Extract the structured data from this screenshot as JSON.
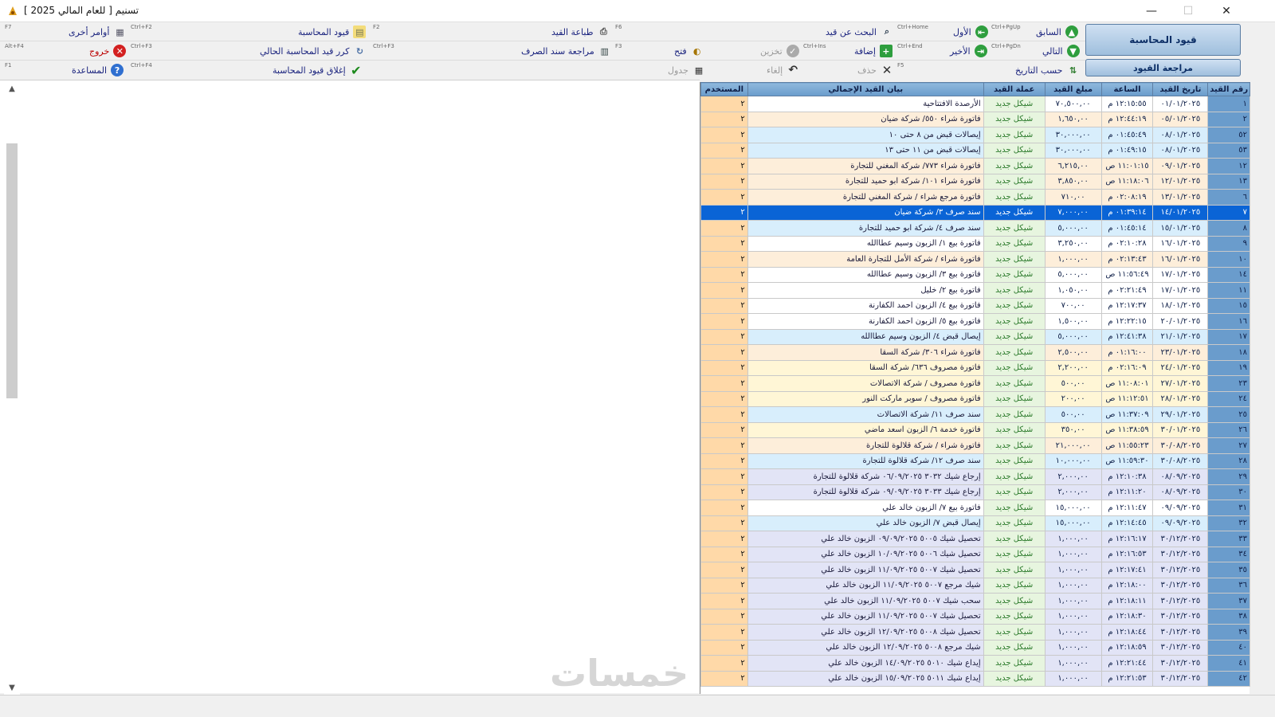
{
  "window": {
    "title": "تسنيم  [ للعام المالي 2025 ]",
    "minimize": "—",
    "maximize": "☐",
    "close": "✕"
  },
  "toolbar": {
    "big_buttons": {
      "journal": "قيود المحاسبة",
      "review": "مراجعة القيود"
    },
    "row1": [
      {
        "label": "السابق",
        "key": "Ctrl+PgUp",
        "icon": "arrow-up-icon",
        "enabled": true
      },
      {
        "label": "الأول",
        "key": "Ctrl+PgUp",
        "icon": "first-icon",
        "enabled": true
      },
      {
        "label": "البحث عن قيد",
        "key": "Ctrl+Home",
        "icon": "search-icon",
        "enabled": true
      },
      {
        "label": "طباعة القيد",
        "key": "F6",
        "icon": "print-icon",
        "enabled": true
      },
      {
        "label": "قيود المحاسبة",
        "key": "F2",
        "icon": "journal-icon",
        "enabled": true
      },
      {
        "label": "أوامر أخرى",
        "key": "Ctrl+F2",
        "icon": "commands-icon",
        "enabled": true
      },
      {
        "label": "",
        "key": "F7",
        "icon": "",
        "enabled": true
      }
    ],
    "row2": [
      {
        "label": "التالي",
        "key": "Ctrl+PgDn",
        "icon": "arrow-down-icon",
        "enabled": true
      },
      {
        "label": "الأخير",
        "key": "Ctrl+PgDn",
        "icon": "last-icon",
        "enabled": true
      },
      {
        "label": "إضافة",
        "key": "Ctrl+End",
        "icon": "add-icon",
        "enabled": true
      },
      {
        "label": "تخزين",
        "key": "Ctrl+Ins",
        "icon": "save-icon",
        "enabled": false
      },
      {
        "label": "فتح",
        "key": "F3",
        "icon": "open-icon",
        "enabled": true
      },
      {
        "label": "مراجعة سند الصرف",
        "key": "F3",
        "icon": "voucher-icon",
        "enabled": true
      },
      {
        "label": "كرر قيد المحاسبة الحالي",
        "key": "Ctrl+F3",
        "icon": "repeat-icon",
        "enabled": true
      },
      {
        "label": "خروج",
        "key": "Alt+F4",
        "icon": "exit-icon",
        "enabled": true
      }
    ],
    "row3": [
      {
        "label": "حسب التاريخ",
        "key": "",
        "icon": "sort-date-icon",
        "enabled": true
      },
      {
        "label": "حذف",
        "key": "F5",
        "icon": "delete-icon",
        "enabled": false
      },
      {
        "label": "إلغاء",
        "key": "",
        "icon": "undo-icon",
        "enabled": false
      },
      {
        "label": "جدول",
        "key": "",
        "icon": "table-icon",
        "enabled": false
      },
      {
        "label": "إغلاق قيود المحاسبة",
        "key": "Ctrl+F4",
        "icon": "check-icon",
        "enabled": true
      },
      {
        "label": "المساعدة",
        "key": "F1",
        "icon": "help-icon",
        "enabled": true
      }
    ]
  },
  "table": {
    "headers": [
      "رقم القيد",
      "تاريخ القيد",
      "الساعة",
      "مبلغ القيد",
      "عملة القيد",
      "بيان القيد الإجمالي",
      "المستخدم"
    ],
    "selected_index": 7,
    "rows": [
      {
        "no": "١",
        "date": "٠١/٠١/٢٠٢٥",
        "time": "١٢:١٥:٥٥ م",
        "amount": "٧٠,٥٠٠,٠٠",
        "currency": "شيكل جديد",
        "statement": "الأرصدة الافتتاحية",
        "user": "٢",
        "tint": "#ffffff"
      },
      {
        "no": "٢",
        "date": "٠٥/٠١/٢٠٢٥",
        "time": "١٢:٤٤:١٩ م",
        "amount": "١,٦٥٠,٠٠",
        "currency": "شيكل جديد",
        "statement": "فاتورة شراء ٥٥٠/ شركة ضيان",
        "user": "٢",
        "tint": "#fdeeda"
      },
      {
        "no": "٥٢",
        "date": "٠٨/٠١/٢٠٢٥",
        "time": "٠١:٤٥:٤٩ م",
        "amount": "٣٠,٠٠٠,٠٠",
        "currency": "شيكل جديد",
        "statement": "إيصالات قبض من ٨ حتى ١٠",
        "user": "٢",
        "tint": "#d8eefc"
      },
      {
        "no": "٥٣",
        "date": "٠٨/٠١/٢٠٢٥",
        "time": "٠١:٤٩:١٥ م",
        "amount": "٣٠,٠٠٠,٠٠",
        "currency": "شيكل جديد",
        "statement": "إيصالات قبض من ١١ حتى ١٣",
        "user": "٢",
        "tint": "#d8eefc"
      },
      {
        "no": "١٢",
        "date": "٠٩/٠١/٢٠٢٥",
        "time": "١١:٠١:١٥ ص",
        "amount": "٦,٢١٥,٠٠",
        "currency": "شيكل جديد",
        "statement": "فاتورة شراء ٧٧٣/ شركة المغني للتجارة",
        "user": "٢",
        "tint": "#fdeeda"
      },
      {
        "no": "١٣",
        "date": "١٢/٠١/٢٠٢٥",
        "time": "١١:١٨:٠٦ ص",
        "amount": "٣,٨٥٠,٠٠",
        "currency": "شيكل جديد",
        "statement": "فاتورة شراء ١٠١/ شركة ابو حميد للتجارة",
        "user": "٢",
        "tint": "#fdeeda"
      },
      {
        "no": "٦",
        "date": "١٣/٠١/٢٠٢٥",
        "time": "٠٢:٠٨:١٩ م",
        "amount": "٧١٠,٠٠",
        "currency": "شيكل جديد",
        "statement": "فاتورة مرجع شراء / شركة المغني للتجارة",
        "user": "٢",
        "tint": "#fdeeda"
      },
      {
        "no": "٧",
        "date": "١٤/٠١/٢٠٢٥",
        "time": "٠١:٣٩:١٤ م",
        "amount": "٧,٠٠٠,٠٠",
        "currency": "شيكل جديد",
        "statement": "سند صرف ٣/ شركة ضيان",
        "user": "٢",
        "tint": "#d8eefc"
      },
      {
        "no": "٨",
        "date": "١٥/٠١/٢٠٢٥",
        "time": "٠١:٤٥:١٤ م",
        "amount": "٥,٠٠٠,٠٠",
        "currency": "شيكل جديد",
        "statement": "سند صرف ٤/ شركة ابو حميد للتجارة",
        "user": "٢",
        "tint": "#d8eefc"
      },
      {
        "no": "٩",
        "date": "١٦/٠١/٢٠٢٥",
        "time": "٠٢:١٠:٢٨ م",
        "amount": "٣,٢٥٠,٠٠",
        "currency": "شيكل جديد",
        "statement": "فاتورة بيع ١/ الزبون وسيم عطاالله",
        "user": "٢",
        "tint": "#ffffff"
      },
      {
        "no": "١٠",
        "date": "١٦/٠١/٢٠٢٥",
        "time": "٠٢:١٣:٤٣ م",
        "amount": "١,٠٠٠,٠٠",
        "currency": "شيكل جديد",
        "statement": "فاتورة شراء / شركة الأمل للتجارة العامة",
        "user": "٢",
        "tint": "#fdeeda"
      },
      {
        "no": "١٤",
        "date": "١٧/٠١/٢٠٢٥",
        "time": "١١:٥٦:٤٩ ص",
        "amount": "٥,٠٠٠,٠٠",
        "currency": "شيكل جديد",
        "statement": "فاتورة بيع ٣/ الزبون وسيم عطاالله",
        "user": "٢",
        "tint": "#ffffff"
      },
      {
        "no": "١١",
        "date": "١٧/٠١/٢٠٢٥",
        "time": "٠٢:٢١:٤٩ م",
        "amount": "١,٠٥٠,٠٠",
        "currency": "شيكل جديد",
        "statement": "فاتورة بيع ٢/ خليل",
        "user": "٢",
        "tint": "#ffffff"
      },
      {
        "no": "١٥",
        "date": "١٨/٠١/٢٠٢٥",
        "time": "١٢:١٧:٣٧ م",
        "amount": "٧٠٠,٠٠",
        "currency": "شيكل جديد",
        "statement": "فاتورة بيع ٤/ الزبون احمد الكفارنة",
        "user": "٢",
        "tint": "#ffffff"
      },
      {
        "no": "١٦",
        "date": "٢٠/٠١/٢٠٢٥",
        "time": "١٢:٢٢:١٥ م",
        "amount": "١,٥٠٠,٠٠",
        "currency": "شيكل جديد",
        "statement": "فاتورة بيع ٥/ الزبون احمد الكفارنة",
        "user": "٢",
        "tint": "#ffffff"
      },
      {
        "no": "١٧",
        "date": "٢١/٠١/٢٠٢٥",
        "time": "١٢:٤١:٣٨ م",
        "amount": "٥,٠٠٠,٠٠",
        "currency": "شيكل جديد",
        "statement": "إيصال قبض ٤/ الزبون وسيم عطاالله",
        "user": "٢",
        "tint": "#d8eefc"
      },
      {
        "no": "١٨",
        "date": "٢٣/٠١/٢٠٢٥",
        "time": "٠١:١٦:٠٠ م",
        "amount": "٢,٥٠٠,٠٠",
        "currency": "شيكل جديد",
        "statement": "فاتورة شراء ٣٠٦/ شركة السقا",
        "user": "٢",
        "tint": "#fdeeda"
      },
      {
        "no": "١٩",
        "date": "٢٤/٠١/٢٠٢٥",
        "time": "٠٢:١٦:٠٩ م",
        "amount": "٢,٢٠٠,٠٠",
        "currency": "شيكل جديد",
        "statement": "فاتورة مصروف ٦٣٦/ شركة السقا",
        "user": "٢",
        "tint": "#fff6d6"
      },
      {
        "no": "٢٣",
        "date": "٢٧/٠١/٢٠٢٥",
        "time": "١١:٠٨:٠١ ص",
        "amount": "٥٠٠,٠٠",
        "currency": "شيكل جديد",
        "statement": "فاتورة مصروف / شركة الاتصالات",
        "user": "٢",
        "tint": "#fff6d6"
      },
      {
        "no": "٢٤",
        "date": "٢٨/٠١/٢٠٢٥",
        "time": "١١:١٢:٥١ ص",
        "amount": "٢٠٠,٠٠",
        "currency": "شيكل جديد",
        "statement": "فاتورة مصروف / سوبر ماركت النور",
        "user": "٢",
        "tint": "#fff6d6"
      },
      {
        "no": "٢٥",
        "date": "٢٩/٠١/٢٠٢٥",
        "time": "١١:٣٧:٠٩ ص",
        "amount": "٥٠٠,٠٠",
        "currency": "شيكل جديد",
        "statement": "سند صرف ١١/ شركة الاتصالات",
        "user": "٢",
        "tint": "#d8eefc"
      },
      {
        "no": "٢٦",
        "date": "٣٠/٠١/٢٠٢٥",
        "time": "١١:٣٨:٥٩ ص",
        "amount": "٣٥٠,٠٠",
        "currency": "شيكل جديد",
        "statement": "فاتورة خدمة ٦/ الزبون اسعد ماضي",
        "user": "٢",
        "tint": "#fff6d6"
      },
      {
        "no": "٢٧",
        "date": "٣٠/٠٨/٢٠٢٥",
        "time": "١١:٥٥:٢٣ ص",
        "amount": "٢١,٠٠٠,٠٠",
        "currency": "شيكل جديد",
        "statement": "فاتورة شراء / شركة قلالوة للتجارة",
        "user": "٢",
        "tint": "#fdeeda"
      },
      {
        "no": "٢٨",
        "date": "٣٠/٠٨/٢٠٢٥",
        "time": "١١:٥٩:٣٠ ص",
        "amount": "١٠,٠٠٠,٠٠",
        "currency": "شيكل جديد",
        "statement": "سند صرف ١٢/ شركة قلالوة للتجارة",
        "user": "٢",
        "tint": "#d8eefc"
      },
      {
        "no": "٢٩",
        "date": "٠٨/٠٩/٢٠٢٥",
        "time": "١٢:١٠:٣٨ م",
        "amount": "٢,٠٠٠,٠٠",
        "currency": "شيكل جديد",
        "statement": "إرجاع شيك ٣٠٣٢ ٠٦/٠٩/٢٠٢٥  شركة قلالوة للتجارة",
        "user": "٢",
        "tint": "#e2e4f6"
      },
      {
        "no": "٣٠",
        "date": "٠٨/٠٩/٢٠٢٥",
        "time": "١٢:١١:٢٠ م",
        "amount": "٢,٠٠٠,٠٠",
        "currency": "شيكل جديد",
        "statement": "إرجاع شيك ٣٠٣٣ ٠٩/٠٩/٢٠٢٥  شركة قلالوة للتجارة",
        "user": "٢",
        "tint": "#e2e4f6"
      },
      {
        "no": "٣١",
        "date": "٠٩/٠٩/٢٠٢٥",
        "time": "١٢:١١:٤٧ م",
        "amount": "١٥,٠٠٠,٠٠",
        "currency": "شيكل جديد",
        "statement": "فاتورة بيع ٧/ الزبون خالد علي",
        "user": "٢",
        "tint": "#ffffff"
      },
      {
        "no": "٣٢",
        "date": "٠٩/٠٩/٢٠٢٥",
        "time": "١٢:١٤:٤٥ م",
        "amount": "١٥,٠٠٠,٠٠",
        "currency": "شيكل جديد",
        "statement": "إيصال قبض ٧/ الزبون خالد علي",
        "user": "٢",
        "tint": "#d8eefc"
      },
      {
        "no": "٣٣",
        "date": "٣٠/١٢/٢٠٢٥",
        "time": "١٢:١٦:١٧ م",
        "amount": "١,٠٠٠,٠٠",
        "currency": "شيكل جديد",
        "statement": "تحصيل شيك ٥٠٠٥ ٠٩/٠٩/٢٠٢٥  الزبون خالد علي",
        "user": "٢",
        "tint": "#e2e4f6"
      },
      {
        "no": "٣٤",
        "date": "٣٠/١٢/٢٠٢٥",
        "time": "١٢:١٦:٥٣ م",
        "amount": "١,٠٠٠,٠٠",
        "currency": "شيكل جديد",
        "statement": "تحصيل شيك ٥٠٠٦ ١٠/٠٩/٢٠٢٥  الزبون خالد علي",
        "user": "٢",
        "tint": "#e2e4f6"
      },
      {
        "no": "٣٥",
        "date": "٣٠/١٢/٢٠٢٥",
        "time": "١٢:١٧:٤١ م",
        "amount": "١,٠٠٠,٠٠",
        "currency": "شيكل جديد",
        "statement": "تحصيل شيك ٥٠٠٧ ١١/٠٩/٢٠٢٥  الزبون خالد علي",
        "user": "٢",
        "tint": "#e2e4f6"
      },
      {
        "no": "٣٦",
        "date": "٣٠/١٢/٢٠٢٥",
        "time": "١٢:١٨:٠٠ م",
        "amount": "١,٠٠٠,٠٠",
        "currency": "شيكل جديد",
        "statement": "شيك مرجع ٥٠٠٧ ١١/٠٩/٢٠٢٥  الزبون خالد علي",
        "user": "٢",
        "tint": "#e2e4f6"
      },
      {
        "no": "٣٧",
        "date": "٣٠/١٢/٢٠٢٥",
        "time": "١٢:١٨:١١ م",
        "amount": "١,٠٠٠,٠٠",
        "currency": "شيكل جديد",
        "statement": "سحب شيك ٥٠٠٧ ١١/٠٩/٢٠٢٥  الزبون خالد علي",
        "user": "٢",
        "tint": "#e2e4f6"
      },
      {
        "no": "٣٨",
        "date": "٣٠/١٢/٢٠٢٥",
        "time": "١٢:١٨:٣٠ م",
        "amount": "١,٠٠٠,٠٠",
        "currency": "شيكل جديد",
        "statement": "تحصيل شيك ٥٠٠٧ ١١/٠٩/٢٠٢٥  الزبون خالد علي",
        "user": "٢",
        "tint": "#e2e4f6"
      },
      {
        "no": "٣٩",
        "date": "٣٠/١٢/٢٠٢٥",
        "time": "١٢:١٨:٤٤ م",
        "amount": "١,٠٠٠,٠٠",
        "currency": "شيكل جديد",
        "statement": "تحصيل شيك ٥٠٠٨ ١٢/٠٩/٢٠٢٥  الزبون خالد علي",
        "user": "٢",
        "tint": "#e2e4f6"
      },
      {
        "no": "٤٠",
        "date": "٣٠/١٢/٢٠٢٥",
        "time": "١٢:١٨:٥٩ م",
        "amount": "١,٠٠٠,٠٠",
        "currency": "شيكل جديد",
        "statement": "شيك مرجع ٥٠٠٨ ١٢/٠٩/٢٠٢٥  الزبون خالد علي",
        "user": "٢",
        "tint": "#e2e4f6"
      },
      {
        "no": "٤١",
        "date": "٣٠/١٢/٢٠٢٥",
        "time": "١٢:٢١:٤٤ م",
        "amount": "١,٠٠٠,٠٠",
        "currency": "شيكل جديد",
        "statement": "إيداع شيك ٥٠١٠ ١٤/٠٩/٢٠٢٥  الزبون خالد علي",
        "user": "٢",
        "tint": "#e2e4f6"
      },
      {
        "no": "٤٢",
        "date": "٣٠/١٢/٢٠٢٥",
        "time": "١٢:٢١:٥٣ م",
        "amount": "١,٠٠٠,٠٠",
        "currency": "شيكل جديد",
        "statement": "إيداع شيك ٥٠١١ ١٥/٠٩/٢٠٢٥  الزبون خالد علي",
        "user": "٢",
        "tint": "#e2e4f6"
      }
    ]
  },
  "watermark": "خمسات"
}
